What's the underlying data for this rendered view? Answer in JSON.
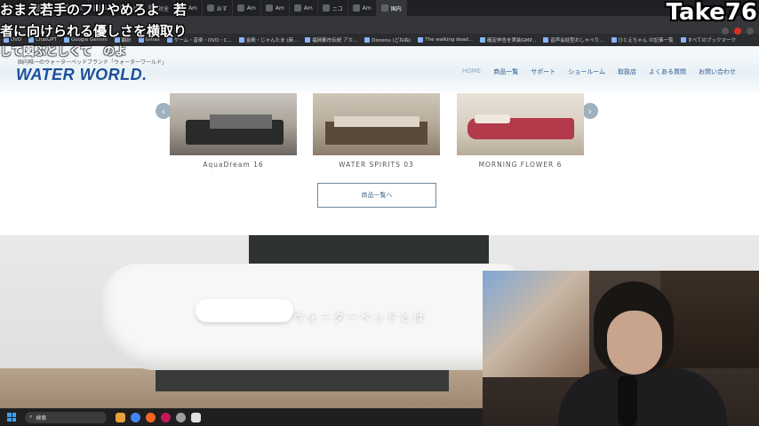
{
  "browser": {
    "tabs": [
      "サボ",
      "X-P",
      "コス",
      "Go",
      "Am",
      "対全",
      "Am",
      "おす",
      "Am",
      "Am",
      "Am",
      "ニコ",
      "Am",
      "国内"
    ],
    "bookmarks": [
      "DVD",
      "ChatGPT",
      "Google Gemini",
      "翻訳",
      "Gmail",
      "ゲーム・音楽・DVD・C...",
      "金殿・じゃんたま (麻...",
      "福岡都市伝説 アカ...",
      "Donenu (どねぬ)",
      "The walking dead...",
      "確定申告を実装GMP...",
      "音声会話型おしゃべり...",
      "ひとえちゃん の記事一覧",
      "すべてのブックマーク"
    ]
  },
  "overlay": {
    "line1": "おまえ若手のフリやめろよ　若",
    "line2": "者に向けられる優しさを横取り",
    "line3": "して図ぶとしくて　のよ",
    "channel": "Take76"
  },
  "site": {
    "tagline": "国内唯一のウォーターベッドブランド「ウォーターワールド」",
    "logo": "WATER WORLD.",
    "nav": [
      "HOME",
      "商品一覧",
      "サポート",
      "ショールーム",
      "取扱店",
      "よくある質問",
      "お問い合わせ"
    ],
    "products": [
      "AquaDream 16",
      "WATER SPIRITS 03",
      "MORNING FLOWER 6"
    ],
    "list_button": "商品一覧へ",
    "hero_title": "ウォーターベッドとは"
  },
  "taskbar": {
    "search_placeholder": "検索"
  }
}
